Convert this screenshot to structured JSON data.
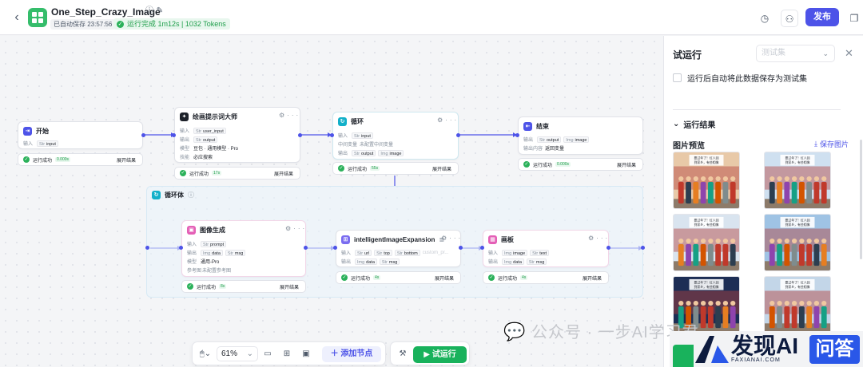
{
  "header": {
    "back_icon": "chevron-left-icon",
    "title": "One_Step_Crazy_Image",
    "saved_text": "已自动保存 23:57:56",
    "run_status": "运行完成 1m12s | 1032 Tokens",
    "publish_label": "发布"
  },
  "nodes": {
    "start": {
      "title": "开始",
      "input_key": "输入",
      "input_type": "Str",
      "input_name": "input",
      "status": "运行成功",
      "time": "0.000s",
      "expand": "展开结果"
    },
    "prompt": {
      "title": "绘画提示词大师",
      "in_key": "输入",
      "in_type": "Str",
      "in_name": "user_input",
      "out_key": "输出",
      "out_type": "Str",
      "out_name": "output",
      "model_key": "模型",
      "model_value": "豆包 · 通用模型 · Pro",
      "skill_key": "技能",
      "skill_value": "必应搜索",
      "status": "运行成功",
      "time": "17s",
      "expand": "展开结果"
    },
    "loop": {
      "title": "循环",
      "in_key": "输入",
      "in_type": "Str",
      "in_name": "input",
      "mid_key": "中间变量",
      "mid_value": "未配置中间变量",
      "out_key": "输出",
      "out_type1": "Str",
      "out_name1": "output",
      "out_type2": "Img",
      "out_name2": "image",
      "status": "运行成功",
      "time": "55s",
      "expand": "展开结果"
    },
    "end": {
      "title": "结束",
      "out_key": "输出",
      "out_type1": "Str",
      "out_name1": "output",
      "out_type2": "Img",
      "out_name2": "image",
      "content_key": "输出内容",
      "content_value": "返回变量",
      "status": "运行成功",
      "time": "0.000s",
      "expand": "展开结果"
    },
    "loop_body": {
      "title": "循环体"
    },
    "image_gen": {
      "title": "图像生成",
      "in_key": "输入",
      "in_type": "Str",
      "in_name": "prompt",
      "out_key": "输出",
      "out_type1": "Img",
      "out_name1": "data",
      "out_type2": "Str",
      "out_name2": "msg",
      "model_key": "模型",
      "model_value": "通用-Pro",
      "ref_key": "参考图",
      "ref_value": "未配置参考图",
      "status": "运行成功",
      "time": "8s",
      "expand": "展开结果"
    },
    "expansion": {
      "title": "intelligentImageExpansion",
      "in_key": "输入",
      "in_type1": "Str",
      "in_name1": "url",
      "in_type2": "Str",
      "in_name2": "top",
      "in_type3": "Str",
      "in_name3": "bottom",
      "in_more": "custom_pr...",
      "out_key": "输出",
      "out_type1": "Img",
      "out_name1": "data",
      "out_type2": "Str",
      "out_name2": "msg",
      "status": "运行成功",
      "time": "4s",
      "expand": "展开结果"
    },
    "canvas_node": {
      "title": "画板",
      "in_key": "输入",
      "in_type1": "Img",
      "in_name1": "image",
      "in_type2": "Str",
      "in_name2": "text",
      "out_key": "输出",
      "out_type1": "Img",
      "out_name1": "data",
      "out_type2": "Str",
      "out_name2": "msg",
      "status": "运行成功",
      "time": "4s",
      "expand": "展开结果"
    }
  },
  "panel": {
    "title": "试运行",
    "testset_placeholder": "测试集",
    "save_checkbox_label": "运行后自动将此数据保存为测试集",
    "results_label": "运行结果",
    "preview_label": "图片预览",
    "save_images_label": "保存图片",
    "thumbnails": [
      {
        "sky": "#e8c9a8",
        "caption": "要过年了！红人回到家乡，有些相像..."
      },
      {
        "sky": "#cfe0f0",
        "caption": "要过年了！红人回到家乡，有些相像..."
      },
      {
        "sky": "#d9e4ef",
        "caption": "要过年了！红人回到家乡，有些相像..."
      },
      {
        "sky": "#9fc3e4",
        "caption": "要过年了！红人回到家乡，有些相像..."
      },
      {
        "sky": "#1d2e55",
        "caption": "要过年了！红人回到家乡，有些相像..."
      },
      {
        "sky": "#c3d6e8",
        "caption": "要过年了！红人回到家乡，有些相像..."
      }
    ]
  },
  "toolbar": {
    "zoom": "61%",
    "add_node_label": "添加节点",
    "test_run_label": "试运行"
  },
  "watermarks": {
    "wechat_text": "公众号 · 一步AI学习君",
    "logo_ai": "发现AI",
    "logo_sub": "FAXIANAI.COM",
    "logo_ask": "问答"
  },
  "colors": {
    "accent": "#4d53e8",
    "success": "#19b25c",
    "loop": "#12b0c9"
  }
}
